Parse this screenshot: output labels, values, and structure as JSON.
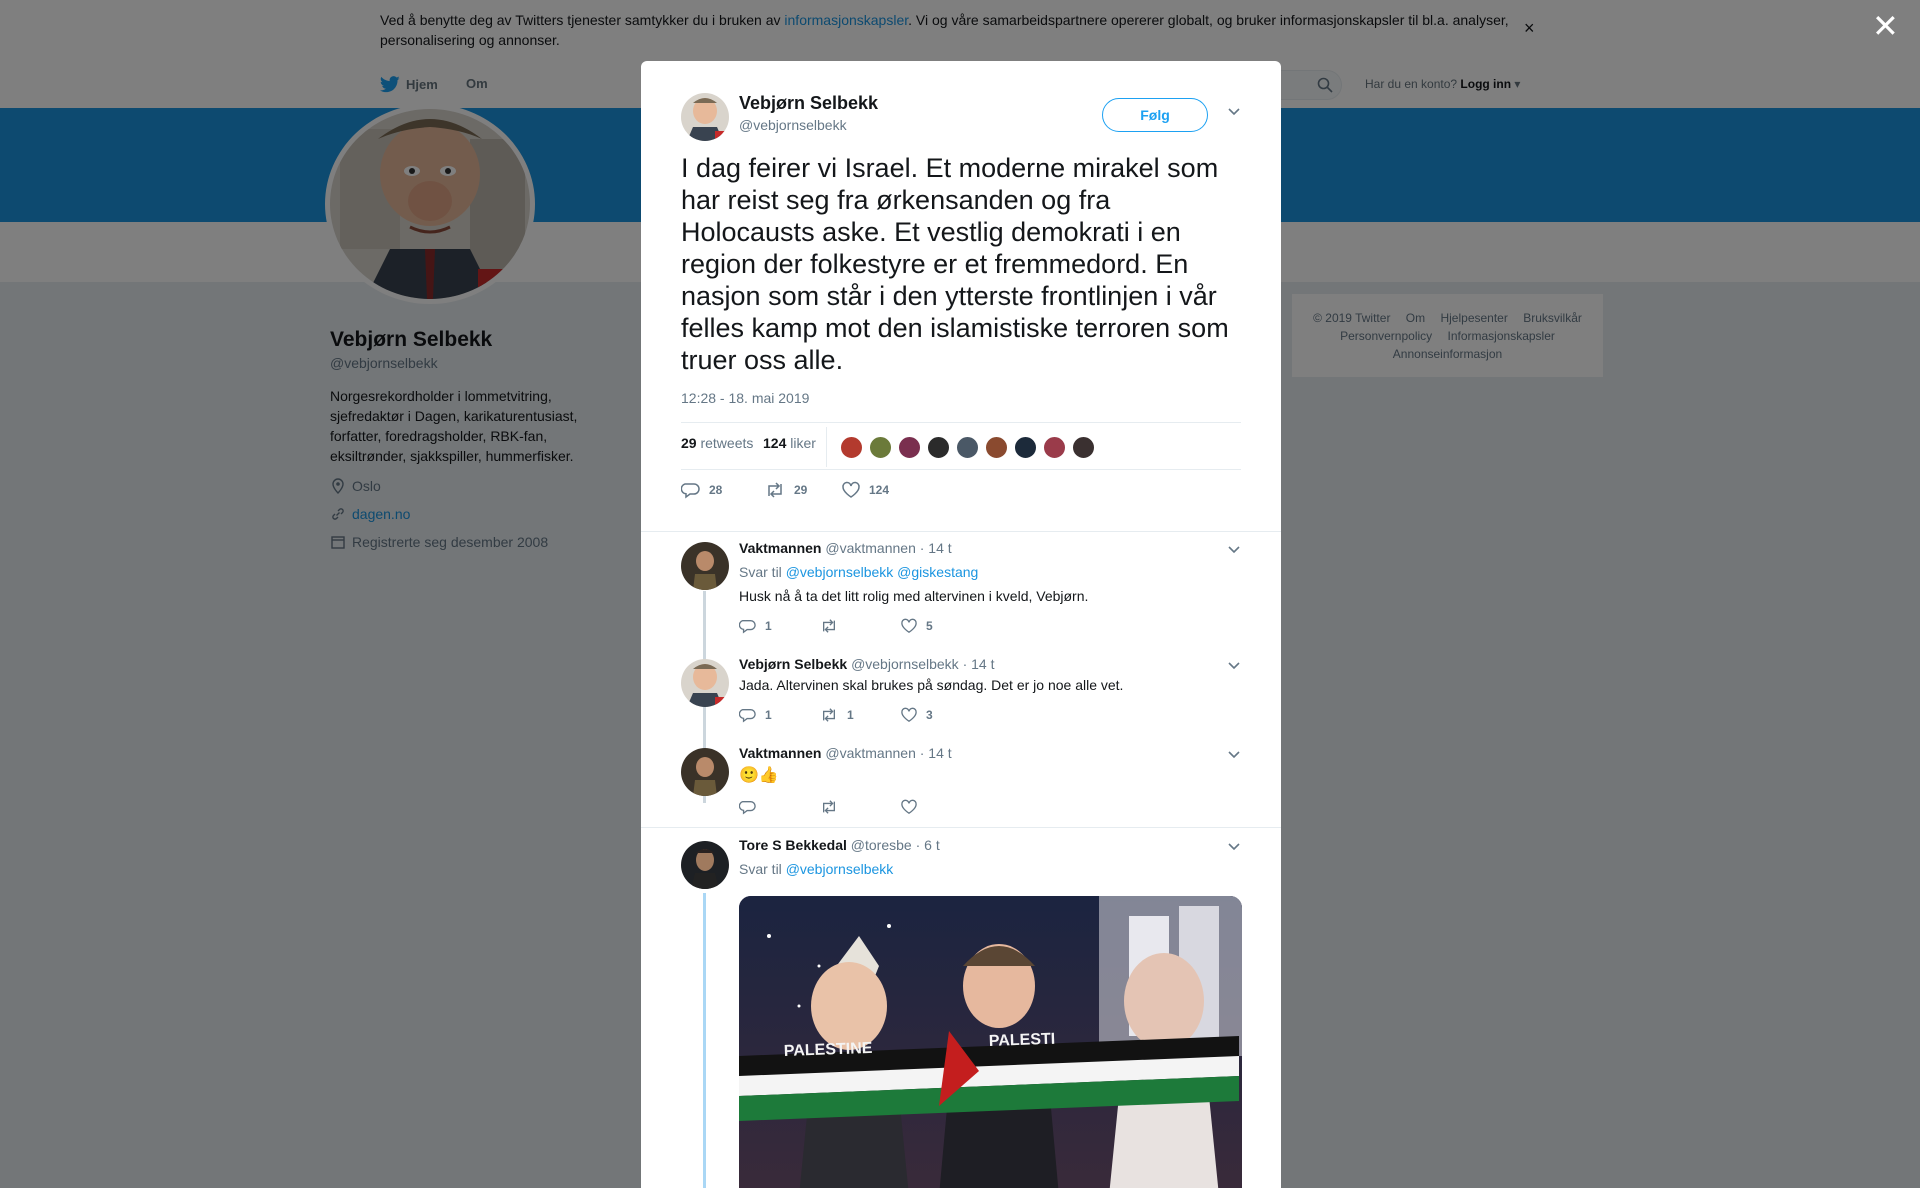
{
  "cookie": {
    "text_before": "Ved å benytte deg av Twitters tjenester samtykker du i bruken av ",
    "link": "informasjonskapsler",
    "text_after": ". Vi og våre samarbeidspartnere opererer globalt, og bruker informasjonskapsler til bl.a. analyser, personalisering og annonser.",
    "close": "×"
  },
  "nav": {
    "home": "Hjem",
    "about": "Om",
    "account_prompt": "Har du en konto?",
    "login": "Logg inn"
  },
  "profile": {
    "name": "Vebjørn Selbekk",
    "handle": "@vebjornselbekk",
    "bio": "Norgesrekordholder i lommetvitring, sjefredaktør i Dagen, karikaturentusiast, forfatter, foredragsholder, RBK-fan, eksiltrønder, sjakkspiller, hummerfisker.",
    "location": "Oslo",
    "website": "dagen.no",
    "joined": "Registrerte seg desember 2008"
  },
  "footer": {
    "copyright": "© 2019 Twitter",
    "about": "Om",
    "help": "Hjelpesenter",
    "terms": "Bruksvilkår",
    "privacy": "Personvernpolicy",
    "cookies": "Informasjonskapsler",
    "ads": "Annonseinformasjon"
  },
  "overlay_close": "✕",
  "tweet": {
    "name": "Vebjørn Selbekk",
    "handle": "@vebjornselbekk",
    "follow": "Følg",
    "text": "I dag feirer vi Israel. Et moderne mirakel som har reist seg fra ørkensanden og fra Holocausts aske. Et vestlig demokrati i en region der folkestyre er et fremmedord. En nasjon som står i den ytterste frontlinjen i vår felles kamp mot den islamistiske terroren som truer oss alle.",
    "time": "12:28 - 18. mai 2019",
    "retweets_count": "29",
    "retweets_label": "retweets",
    "likes_count": "124",
    "likes_label": "liker",
    "replies": "28",
    "retweets": "29",
    "likes": "124",
    "liker_colors": [
      "#b33a2e",
      "#6b7a3a",
      "#7a2f4f",
      "#2b2b2b",
      "#4a5866",
      "#8a4a2f",
      "#1c2a3a",
      "#9a3b4a",
      "#3a3030"
    ]
  },
  "replies": [
    {
      "name": "Vaktmannen",
      "handle": "@vaktmannen",
      "time": "· 14 t",
      "reply_to_label": "Svar til",
      "reply_to": "@vebjornselbekk @giskestang",
      "text": "Husk nå å ta det litt rolig med altervinen i kveld, Vebjørn.",
      "replies": "1",
      "retweets": "",
      "likes": "5"
    },
    {
      "name": "Vebjørn Selbekk",
      "handle": "@vebjornselbekk",
      "time": "· 14 t",
      "text": "Jada. Altervinen skal brukes på søndag. Det er jo noe alle vet.",
      "replies": "1",
      "retweets": "1",
      "likes": "3"
    },
    {
      "name": "Vaktmannen",
      "handle": "@vaktmannen",
      "time": "· 14 t",
      "text": "🙂👍",
      "replies": "",
      "retweets": "",
      "likes": ""
    },
    {
      "name": "Tore S Bekkedal",
      "handle": "@toresbe",
      "time": "· 6 t",
      "reply_to_label": "Svar til",
      "reply_to": "@vebjornselbekk",
      "media_flag_text_1": "PALESTINE",
      "media_flag_text_2": "PALESTI"
    }
  ]
}
